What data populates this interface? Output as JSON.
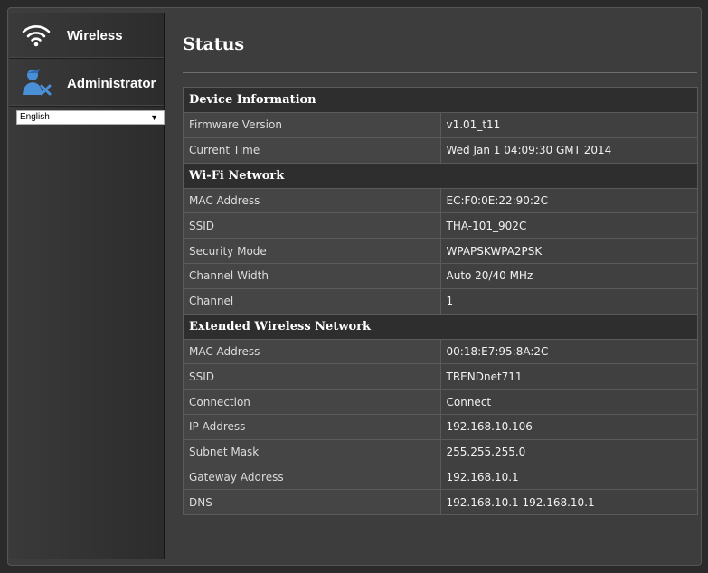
{
  "sidebar": {
    "items": [
      {
        "label": "Wireless",
        "icon": "wifi-icon"
      },
      {
        "label": "Administrator",
        "icon": "admin-user-icon"
      }
    ],
    "language": {
      "selected": "English"
    }
  },
  "main": {
    "title": "Status",
    "sections": [
      {
        "title": "Device Information",
        "rows": [
          {
            "key": "Firmware Version",
            "value": "v1.01_t11"
          },
          {
            "key": "Current Time",
            "value": "Wed Jan 1 04:09:30 GMT 2014"
          }
        ]
      },
      {
        "title": "Wi-Fi Network",
        "rows": [
          {
            "key": "MAC Address",
            "value": "EC:F0:0E:22:90:2C"
          },
          {
            "key": "SSID",
            "value": "THA-101_902C"
          },
          {
            "key": "Security Mode",
            "value": "WPAPSKWPA2PSK"
          },
          {
            "key": "Channel Width",
            "value": "Auto 20/40 MHz"
          },
          {
            "key": "Channel",
            "value": "1"
          }
        ]
      },
      {
        "title": "Extended Wireless Network",
        "rows": [
          {
            "key": "MAC Address",
            "value": "00:18:E7:95:8A:2C"
          },
          {
            "key": "SSID",
            "value": "TRENDnet711"
          },
          {
            "key": "Connection",
            "value": "Connect"
          },
          {
            "key": "IP Address",
            "value": "192.168.10.106"
          },
          {
            "key": "Subnet Mask",
            "value": "255.255.255.0"
          },
          {
            "key": "Gateway Address",
            "value": "192.168.10.1"
          },
          {
            "key": "DNS",
            "value": "192.168.10.1 192.168.10.1"
          }
        ]
      }
    ]
  },
  "colors": {
    "background": "#3d3d3d",
    "section_header": "#2e2e2e",
    "admin_icon": "#4a8fd6"
  }
}
